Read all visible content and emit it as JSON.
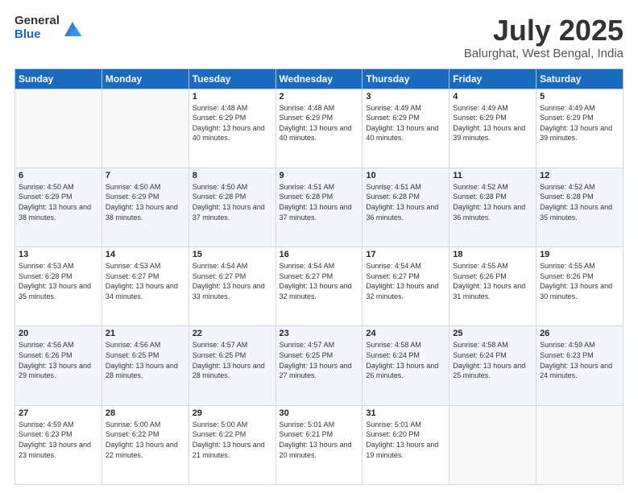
{
  "header": {
    "logo_general": "General",
    "logo_blue": "Blue",
    "month_title": "July 2025",
    "location": "Balurghat, West Bengal, India"
  },
  "days_of_week": [
    "Sunday",
    "Monday",
    "Tuesday",
    "Wednesday",
    "Thursday",
    "Friday",
    "Saturday"
  ],
  "weeks": [
    [
      {
        "day": "",
        "info": ""
      },
      {
        "day": "",
        "info": ""
      },
      {
        "day": "1",
        "info": "Sunrise: 4:48 AM\nSunset: 6:29 PM\nDaylight: 13 hours and 40 minutes."
      },
      {
        "day": "2",
        "info": "Sunrise: 4:48 AM\nSunset: 6:29 PM\nDaylight: 13 hours and 40 minutes."
      },
      {
        "day": "3",
        "info": "Sunrise: 4:49 AM\nSunset: 6:29 PM\nDaylight: 13 hours and 40 minutes."
      },
      {
        "day": "4",
        "info": "Sunrise: 4:49 AM\nSunset: 6:29 PM\nDaylight: 13 hours and 39 minutes."
      },
      {
        "day": "5",
        "info": "Sunrise: 4:49 AM\nSunset: 6:29 PM\nDaylight: 13 hours and 39 minutes."
      }
    ],
    [
      {
        "day": "6",
        "info": "Sunrise: 4:50 AM\nSunset: 6:29 PM\nDaylight: 13 hours and 38 minutes."
      },
      {
        "day": "7",
        "info": "Sunrise: 4:50 AM\nSunset: 6:29 PM\nDaylight: 13 hours and 38 minutes."
      },
      {
        "day": "8",
        "info": "Sunrise: 4:50 AM\nSunset: 6:28 PM\nDaylight: 13 hours and 37 minutes."
      },
      {
        "day": "9",
        "info": "Sunrise: 4:51 AM\nSunset: 6:28 PM\nDaylight: 13 hours and 37 minutes."
      },
      {
        "day": "10",
        "info": "Sunrise: 4:51 AM\nSunset: 6:28 PM\nDaylight: 13 hours and 36 minutes."
      },
      {
        "day": "11",
        "info": "Sunrise: 4:52 AM\nSunset: 6:28 PM\nDaylight: 13 hours and 36 minutes."
      },
      {
        "day": "12",
        "info": "Sunrise: 4:52 AM\nSunset: 6:28 PM\nDaylight: 13 hours and 35 minutes."
      }
    ],
    [
      {
        "day": "13",
        "info": "Sunrise: 4:53 AM\nSunset: 6:28 PM\nDaylight: 13 hours and 35 minutes."
      },
      {
        "day": "14",
        "info": "Sunrise: 4:53 AM\nSunset: 6:27 PM\nDaylight: 13 hours and 34 minutes."
      },
      {
        "day": "15",
        "info": "Sunrise: 4:54 AM\nSunset: 6:27 PM\nDaylight: 13 hours and 33 minutes."
      },
      {
        "day": "16",
        "info": "Sunrise: 4:54 AM\nSunset: 6:27 PM\nDaylight: 13 hours and 32 minutes."
      },
      {
        "day": "17",
        "info": "Sunrise: 4:54 AM\nSunset: 6:27 PM\nDaylight: 13 hours and 32 minutes."
      },
      {
        "day": "18",
        "info": "Sunrise: 4:55 AM\nSunset: 6:26 PM\nDaylight: 13 hours and 31 minutes."
      },
      {
        "day": "19",
        "info": "Sunrise: 4:55 AM\nSunset: 6:26 PM\nDaylight: 13 hours and 30 minutes."
      }
    ],
    [
      {
        "day": "20",
        "info": "Sunrise: 4:56 AM\nSunset: 6:26 PM\nDaylight: 13 hours and 29 minutes."
      },
      {
        "day": "21",
        "info": "Sunrise: 4:56 AM\nSunset: 6:25 PM\nDaylight: 13 hours and 28 minutes."
      },
      {
        "day": "22",
        "info": "Sunrise: 4:57 AM\nSunset: 6:25 PM\nDaylight: 13 hours and 28 minutes."
      },
      {
        "day": "23",
        "info": "Sunrise: 4:57 AM\nSunset: 6:25 PM\nDaylight: 13 hours and 27 minutes."
      },
      {
        "day": "24",
        "info": "Sunrise: 4:58 AM\nSunset: 6:24 PM\nDaylight: 13 hours and 26 minutes."
      },
      {
        "day": "25",
        "info": "Sunrise: 4:58 AM\nSunset: 6:24 PM\nDaylight: 13 hours and 25 minutes."
      },
      {
        "day": "26",
        "info": "Sunrise: 4:59 AM\nSunset: 6:23 PM\nDaylight: 13 hours and 24 minutes."
      }
    ],
    [
      {
        "day": "27",
        "info": "Sunrise: 4:59 AM\nSunset: 6:23 PM\nDaylight: 13 hours and 23 minutes."
      },
      {
        "day": "28",
        "info": "Sunrise: 5:00 AM\nSunset: 6:22 PM\nDaylight: 13 hours and 22 minutes."
      },
      {
        "day": "29",
        "info": "Sunrise: 5:00 AM\nSunset: 6:22 PM\nDaylight: 13 hours and 21 minutes."
      },
      {
        "day": "30",
        "info": "Sunrise: 5:01 AM\nSunset: 6:21 PM\nDaylight: 13 hours and 20 minutes."
      },
      {
        "day": "31",
        "info": "Sunrise: 5:01 AM\nSunset: 6:20 PM\nDaylight: 13 hours and 19 minutes."
      },
      {
        "day": "",
        "info": ""
      },
      {
        "day": "",
        "info": ""
      }
    ]
  ]
}
